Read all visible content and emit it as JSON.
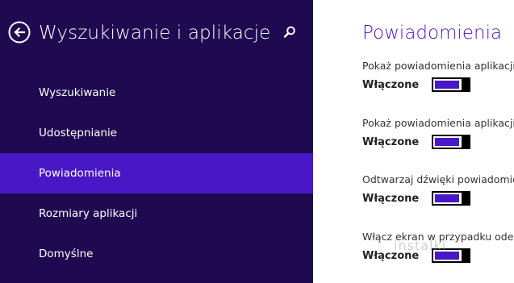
{
  "left_pane": {
    "title": "Wyszukiwanie i aplikacje",
    "back_icon": "back-arrow-circle-icon",
    "search_icon": "search-icon",
    "nav_items": [
      {
        "label": "Wyszukiwanie",
        "selected": false
      },
      {
        "label": "Udostępnianie",
        "selected": false
      },
      {
        "label": "Powiadomienia",
        "selected": true
      },
      {
        "label": "Rozmiary aplikacji",
        "selected": false
      },
      {
        "label": "Domyślne",
        "selected": false
      }
    ]
  },
  "right_pane": {
    "title": "Powiadomienia",
    "settings": [
      {
        "label": "Pokaż powiadomienia aplikacji",
        "state": "Włączone",
        "on": true
      },
      {
        "label": "Pokaż powiadomienia aplikacji",
        "state": "Włączone",
        "on": true
      },
      {
        "label": "Odtwarzaj dźwięki powiadomień",
        "state": "Włączone",
        "on": true
      },
      {
        "label": "Włącz ekran w przypadku odebrania",
        "state": "Włączone",
        "on": true
      }
    ]
  },
  "watermark": "instalki",
  "colors": {
    "left_background": "#1f0a52",
    "selected_background": "#4a17c6",
    "accent": "#4a17c6",
    "right_background": "#ffffff"
  }
}
